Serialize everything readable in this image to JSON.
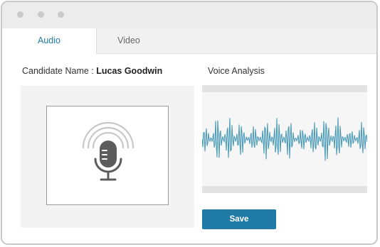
{
  "tabs": [
    {
      "label": "Audio",
      "active": true
    },
    {
      "label": "Video",
      "active": false
    }
  ],
  "candidate": {
    "label": "Candidate Name : ",
    "name": "Lucas Goodwin"
  },
  "voice_analysis": {
    "title": "Voice Analysis"
  },
  "icons": {
    "mic": "microphone-icon",
    "broadcast": "broadcast-waves-icon"
  },
  "actions": {
    "save_label": "Save"
  },
  "colors": {
    "accent": "#1f7aa6",
    "waveform": "#4a9bb8"
  }
}
